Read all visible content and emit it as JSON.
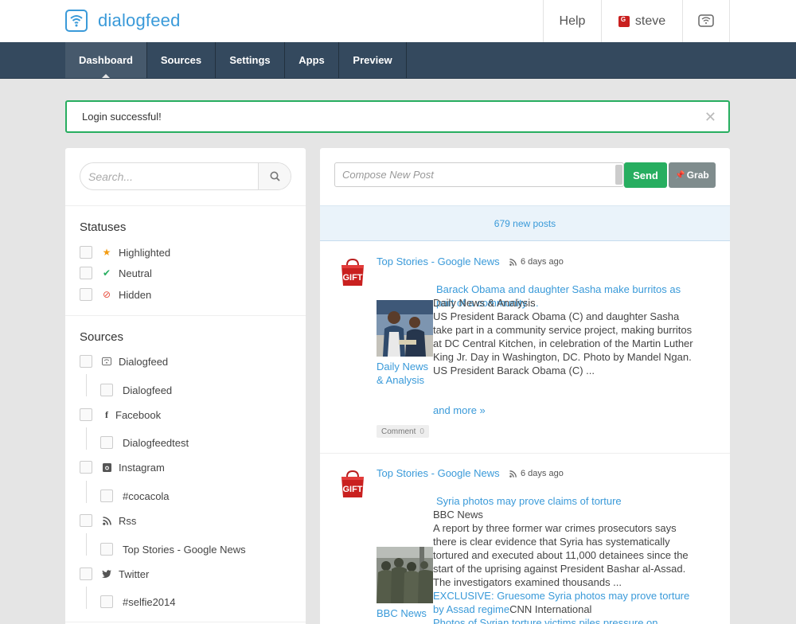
{
  "brand": {
    "name": "dialogfeed"
  },
  "top_nav": {
    "help": "Help",
    "user": "steve"
  },
  "nav": {
    "tabs": [
      {
        "label": "Dashboard"
      },
      {
        "label": "Sources"
      },
      {
        "label": "Settings"
      },
      {
        "label": "Apps"
      },
      {
        "label": "Preview"
      }
    ]
  },
  "alert": {
    "message": "Login successful!"
  },
  "search": {
    "placeholder": "Search..."
  },
  "statuses": {
    "title": "Statuses",
    "items": [
      {
        "label": "Highlighted"
      },
      {
        "label": "Neutral"
      },
      {
        "label": "Hidden"
      }
    ]
  },
  "sources": {
    "title": "Sources",
    "groups": [
      {
        "label": "Dialogfeed",
        "child": "Dialogfeed"
      },
      {
        "label": "Facebook",
        "child": "Dialogfeedtest"
      },
      {
        "label": "Instagram",
        "child": "#cocacola"
      },
      {
        "label": "Rss",
        "child": "Top Stories - Google News"
      },
      {
        "label": "Twitter",
        "child": "#selfie2014"
      }
    ]
  },
  "compose": {
    "placeholder": "Compose New Post",
    "send": "Send",
    "grab": "Grab"
  },
  "feed": {
    "new_posts": "679 new posts",
    "posts": [
      {
        "source": "Top Stories - Google News",
        "time": "6 days ago",
        "title": "Barack Obama and daughter Sasha make burritos as part of a community ...",
        "publisher": "Daily News & Analysis",
        "caption": "Daily News & Analysis",
        "body": "US President Barack Obama (C) and daughter Sasha take part in a community service project, making burritos at DC Central Kitchen, in celebration of the Martin Luther King Jr. Day in Washington, DC. Photo by Mandel Ngan. US President Barack Obama (C) ...",
        "more": "and more »",
        "comment_label": "Comment",
        "comment_count": "0"
      },
      {
        "source": "Top Stories - Google News",
        "time": "6 days ago",
        "title": "Syria photos may prove claims of torture",
        "publisher": "BBC News",
        "caption": "BBC News",
        "body": "A report by three former war crimes prosecutors says there is clear evidence that Syria has systematically tortured and executed about 11,000 detainees since the start of the uprising against President Bashar al-Assad. The investigators examined thousands ...",
        "link1": "EXCLUSIVE: Gruesome Syria photos may prove torture by Assad regime",
        "link1_source": "CNN International",
        "link2": "Photos of Syrian torture victims piles pressure on ..."
      }
    ]
  },
  "colors": {
    "accent": "#3a9ad9",
    "navbar": "#34495e",
    "success": "#27ae60",
    "grab": "#7f8c8d"
  }
}
